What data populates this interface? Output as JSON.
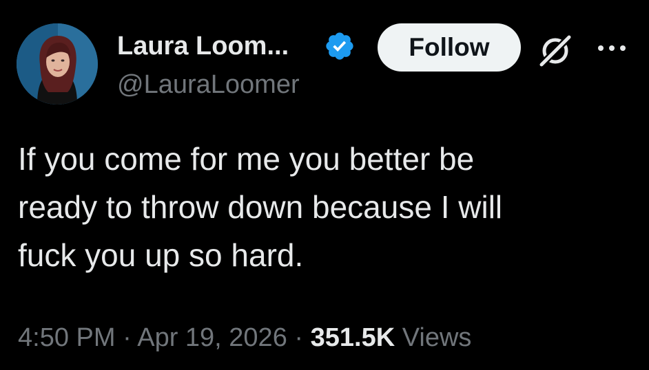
{
  "author": {
    "display_name": "Laura Loom...",
    "handle": "@LauraLoomer",
    "verified": true
  },
  "actions": {
    "follow_label": "Follow",
    "grok_icon": "grok-icon",
    "more_icon": "more-icon"
  },
  "tweet": {
    "text": "If you come for me you better be\nready to throw down because I will\nfuck you up so hard."
  },
  "meta": {
    "time": "4:50 PM",
    "sep1": " · ",
    "date": "Apr 19, 2026",
    "sep2": " · ",
    "views_count": "351.5K",
    "views_label": " Views"
  },
  "colors": {
    "background": "#000000",
    "text_primary": "#e7e9ea",
    "text_secondary": "#71767b",
    "verified_blue": "#1d9bf0",
    "follow_bg": "#eff3f4"
  }
}
